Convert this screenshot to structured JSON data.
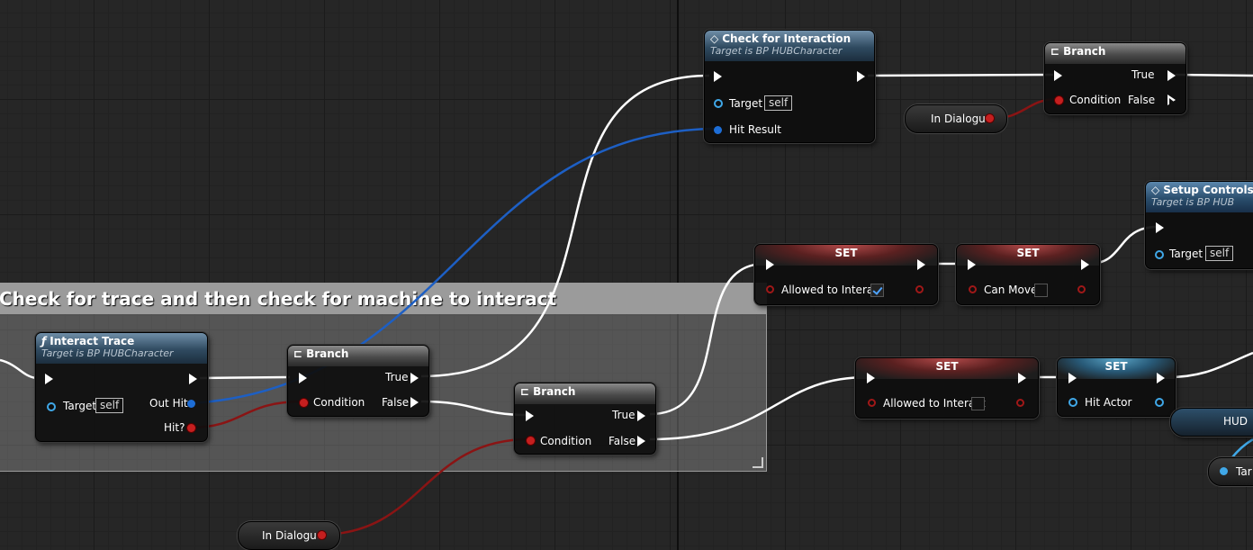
{
  "comment": {
    "title": "Check for trace and then check for machine to interact"
  },
  "nodes": {
    "check_interaction": {
      "title": "Check for Interaction",
      "subtitle": "Target is BP HUBCharacter",
      "target_label": "Target",
      "target_value": "self",
      "hit_result_label": "Hit Result"
    },
    "branch_top": {
      "title": "Branch",
      "condition_label": "Condition",
      "true_label": "True",
      "false_label": "False"
    },
    "in_dialogue_top": {
      "label": "In Dialogue"
    },
    "setup_controls": {
      "title": "Setup Controls",
      "subtitle": "Target is BP HUB",
      "target_label": "Target",
      "target_value": "self"
    },
    "set_allowed_1": {
      "title": "SET",
      "field_label": "Allowed to Interact",
      "checked": true
    },
    "set_can_move": {
      "title": "SET",
      "field_label": "Can Move",
      "checked": false
    },
    "interact_trace": {
      "title": "Interact Trace",
      "subtitle": "Target is BP HUBCharacter",
      "target_label": "Target",
      "target_value": "self",
      "out_hit_label": "Out Hit",
      "hit_label": "Hit?"
    },
    "branch_1": {
      "title": "Branch",
      "condition_label": "Condition",
      "true_label": "True",
      "false_label": "False"
    },
    "branch_2": {
      "title": "Branch",
      "condition_label": "Condition",
      "true_label": "True",
      "false_label": "False"
    },
    "set_allowed_2": {
      "title": "SET",
      "field_label": "Allowed to Interact",
      "checked": false
    },
    "set_hit_actor": {
      "title": "SET",
      "field_label": "Hit Actor"
    },
    "hud": {
      "label": "HUD"
    },
    "target_partial": {
      "label": "Tar"
    },
    "in_dialogue_bottom": {
      "label": "In Dialogue"
    }
  },
  "colors": {
    "exec": "#ffffff",
    "bool": "#a01818",
    "struct": "#1d5fc4",
    "object": "#40a8e8"
  }
}
